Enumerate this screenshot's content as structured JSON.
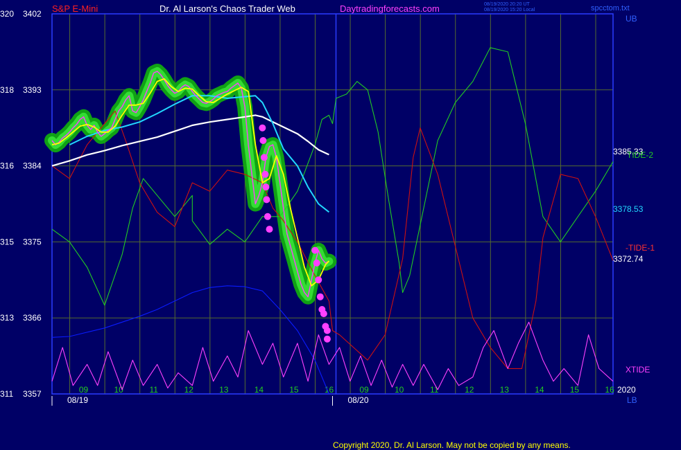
{
  "header": {
    "instrument": "S&P E-Mini",
    "site": "Dr. Al Larson's Chaos Trader Web",
    "url": "Daytradingforecasts.com",
    "stamp_ut": "08/19/2020 20:20 UT",
    "stamp_local": "08/19/2020 15:20 Local",
    "file": "spcctom.txt"
  },
  "footer": {
    "copyright": "Copyright 2020, Dr. Al Larson. May not be copied by any means."
  },
  "colors": {
    "background": "#000066",
    "frame": "#2a3cff",
    "grid": "#556b2f",
    "green_line": "#22cc22",
    "red_line": "#cc1111",
    "blue_line": "#0a1cff",
    "magenta_line": "#ff40ff",
    "cyan_ma": "#22d8ff",
    "white_ma": "#ffffff",
    "yellow_ma": "#ffff00",
    "glow": "#11aa11"
  },
  "chart_data": {
    "type": "line",
    "title": "S&P E-Mini",
    "ylim": [
      3357,
      3402
    ],
    "y_ticks": [
      {
        "left": "320",
        "price": "3402"
      },
      {
        "left": "318",
        "price": "3393"
      },
      {
        "left": "316",
        "price": "3384"
      },
      {
        "left": "315",
        "price": "3375"
      },
      {
        "left": "313",
        "price": "3366"
      },
      {
        "left": "311",
        "price": "3357"
      }
    ],
    "x_hour_labels": [
      {
        "label": "09",
        "x": 2.0
      },
      {
        "label": "10",
        "x": 3.0
      },
      {
        "label": "11",
        "x": 4.0
      },
      {
        "label": "12",
        "x": 5.0
      },
      {
        "label": "13",
        "x": 6.0
      },
      {
        "label": "14",
        "x": 7.0
      },
      {
        "label": "15",
        "x": 8.0
      },
      {
        "label": "16",
        "x": 9.0
      },
      {
        "label": "09",
        "x": 10.0
      },
      {
        "label": "10",
        "x": 11.0
      },
      {
        "label": "11",
        "x": 12.0
      },
      {
        "label": "12",
        "x": 13.0
      },
      {
        "label": "13",
        "x": 14.0
      },
      {
        "label": "14",
        "x": 15.0
      },
      {
        "label": "15",
        "x": 16.0
      },
      {
        "label": "16",
        "x": 17.0
      }
    ],
    "date_labels": [
      {
        "label": "08/19",
        "x": 1.0
      },
      {
        "label": "08/20",
        "x": 9.0
      }
    ],
    "right_labels": {
      "ub": "UB",
      "lb": "LB",
      "ma_white": "3385.33",
      "ma_cyan": "3378.53",
      "ma_yellow": "3372.74",
      "tide2": "TIDE-2",
      "tide1": "-TIDE-1",
      "xtide": "XTIDE",
      "year": "2020"
    },
    "series": [
      {
        "name": "price",
        "color": "#ff40ff",
        "x": [
          1.0,
          1.1,
          1.2,
          1.3,
          1.4,
          1.5,
          1.6,
          1.7,
          1.8,
          1.9,
          2.0,
          2.1,
          2.2,
          2.3,
          2.4,
          2.5,
          2.6,
          2.7,
          2.8,
          2.9,
          3.0,
          3.1,
          3.2,
          3.3,
          3.4,
          3.5,
          3.6,
          3.7,
          3.8,
          3.9,
          4.0,
          4.1,
          4.2,
          4.3,
          4.4,
          4.5,
          4.6,
          4.7,
          4.8,
          4.9,
          5.0,
          5.1,
          5.2,
          5.3,
          5.4,
          5.5,
          5.6,
          5.7,
          5.8,
          5.9,
          6.0,
          6.1,
          6.2,
          6.3,
          6.4,
          6.5,
          6.6,
          6.7,
          6.8,
          6.9,
          7.0,
          7.1,
          7.2,
          7.3,
          7.4,
          7.5,
          7.6,
          7.7,
          7.8,
          7.9,
          8.0,
          8.1,
          8.2,
          8.3,
          8.4,
          8.5,
          8.6,
          8.7,
          8.8,
          8.9
        ],
        "values": [
          3387.0,
          3386.5,
          3386.8,
          3387.3,
          3387.6,
          3388.0,
          3388.5,
          3388.9,
          3389.5,
          3389.8,
          3388.8,
          3388.3,
          3388.8,
          3388.0,
          3387.5,
          3387.8,
          3388.2,
          3388.5,
          3389.5,
          3390.5,
          3391.0,
          3391.8,
          3392.3,
          3390.5,
          3390.3,
          3391.0,
          3391.8,
          3392.8,
          3393.8,
          3395.0,
          3395.2,
          3394.8,
          3394.2,
          3393.5,
          3393.0,
          3392.6,
          3392.8,
          3393.3,
          3393.6,
          3393.4,
          3392.8,
          3392.3,
          3391.9,
          3391.5,
          3391.4,
          3391.6,
          3391.9,
          3392.3,
          3392.5,
          3392.7,
          3392.8,
          3393.2,
          3393.5,
          3393.8,
          3393.2,
          3391.0,
          3386.5,
          3383.0,
          3379.5,
          3380.5,
          3382.0,
          3385.0,
          3386.3,
          3386.5,
          3385.0,
          3382.0,
          3379.0,
          3376.0,
          3374.5,
          3373.0,
          3371.5,
          3370.0,
          3369.0,
          3368.5,
          3370.5,
          3372.5,
          3374.0,
          3373.0,
          3372.5,
          3372.7
        ]
      },
      {
        "name": "yellow-ma",
        "color": "#ffff00",
        "x": [
          1.0,
          1.2,
          1.4,
          1.6,
          1.8,
          2.0,
          2.2,
          2.4,
          2.6,
          2.8,
          3.0,
          3.2,
          3.4,
          3.6,
          3.8,
          4.0,
          4.2,
          4.4,
          4.6,
          4.8,
          5.0,
          5.2,
          5.4,
          5.6,
          5.8,
          6.0,
          6.2,
          6.4,
          6.6,
          6.8,
          7.0,
          7.2,
          7.4,
          7.6,
          7.8,
          8.0,
          8.2,
          8.4,
          8.6,
          8.8,
          8.9
        ],
        "values": [
          3386.5,
          3386.7,
          3387.3,
          3388.0,
          3388.7,
          3388.9,
          3388.6,
          3388.0,
          3388.0,
          3388.7,
          3390.0,
          3391.2,
          3391.2,
          3391.4,
          3392.6,
          3394.0,
          3394.3,
          3393.4,
          3392.8,
          3393.2,
          3393.1,
          3392.3,
          3391.6,
          3391.5,
          3392.0,
          3392.5,
          3392.9,
          3393.3,
          3392.8,
          3386.5,
          3382.0,
          3382.5,
          3385.2,
          3383.0,
          3379.0,
          3375.5,
          3372.0,
          3369.8,
          3370.5,
          3372.3,
          3372.74
        ]
      },
      {
        "name": "cyan-ma",
        "color": "#22d8ff",
        "x": [
          1.5,
          2.0,
          2.5,
          3.0,
          3.5,
          4.0,
          4.5,
          5.0,
          5.5,
          6.0,
          6.5,
          6.8,
          7.0,
          7.3,
          7.6,
          8.0,
          8.3,
          8.6,
          8.9
        ],
        "values": [
          3386.5,
          3387.5,
          3388.2,
          3388.6,
          3389.2,
          3390.2,
          3391.3,
          3392.3,
          3392.3,
          3392.0,
          3392.2,
          3392.3,
          3391.5,
          3389.0,
          3386.0,
          3384.0,
          3381.5,
          3379.5,
          3378.53
        ]
      },
      {
        "name": "white-ma",
        "color": "#ffffff",
        "x": [
          1.0,
          1.5,
          2.0,
          2.5,
          3.0,
          3.5,
          4.0,
          4.5,
          5.0,
          5.5,
          6.0,
          6.5,
          6.8,
          7.0,
          7.2,
          7.4,
          7.6,
          7.8,
          8.0,
          8.3,
          8.6,
          8.9
        ],
        "values": [
          3384.0,
          3384.6,
          3385.3,
          3385.8,
          3386.4,
          3386.9,
          3387.4,
          3388.1,
          3388.8,
          3389.2,
          3389.5,
          3389.8,
          3390.0,
          3389.8,
          3389.4,
          3389.0,
          3388.6,
          3388.2,
          3387.8,
          3386.9,
          3385.9,
          3385.33
        ]
      },
      {
        "name": "TIDE-2",
        "color": "#22cc22",
        "x": [
          1.0,
          1.5,
          2.0,
          2.5,
          3.0,
          3.3,
          3.6,
          4.0,
          4.5,
          5.0,
          5.0,
          5.5,
          6.0,
          6.5,
          7.0,
          7.5,
          8.0,
          8.5,
          8.7,
          8.9,
          9.0,
          9.1,
          9.4,
          9.7,
          10.0,
          10.3,
          10.6,
          10.9,
          11.0,
          11.2,
          11.5,
          12.0,
          12.5,
          13.0,
          13.5,
          14.0,
          14.5,
          15.0,
          15.5,
          16.0,
          16.5,
          17.0
        ],
        "values": [
          3376.5,
          3375.0,
          3372.0,
          3367.5,
          3373.5,
          3379.0,
          3382.5,
          3380.5,
          3378.0,
          3380.5,
          3377.5,
          3374.7,
          3376.5,
          3375.0,
          3378.0,
          3378.0,
          3381.0,
          3386.5,
          3389.5,
          3390.0,
          3389.0,
          3392.0,
          3392.5,
          3394.0,
          3393.0,
          3388.0,
          3380.0,
          3372.5,
          3369.0,
          3371.0,
          3377.0,
          3387.0,
          3391.5,
          3394.0,
          3398.0,
          3397.5,
          3389.0,
          3378.0,
          3375.0,
          3378.0,
          3381.0,
          3384.5
        ]
      },
      {
        "name": "TIDE-1",
        "color": "#cc1111",
        "x": [
          1.0,
          1.5,
          2.0,
          2.5,
          2.8,
          3.1,
          3.5,
          4.0,
          4.5,
          5.0,
          5.5,
          6.0,
          6.5,
          7.0,
          7.3,
          7.6,
          8.0,
          8.5,
          8.9,
          9.0,
          9.2,
          9.6,
          10.0,
          10.5,
          11.0,
          11.3,
          11.5,
          12.0,
          12.5,
          13.0,
          13.5,
          14.0,
          14.4,
          14.8,
          15.0,
          15.5,
          16.0,
          16.5,
          17.0
        ],
        "values": [
          3384.0,
          3382.5,
          3386.5,
          3389.0,
          3390.5,
          3387.0,
          3382.0,
          3378.5,
          3376.8,
          3382.0,
          3381.0,
          3383.5,
          3383.0,
          3382.0,
          3379.0,
          3377.5,
          3375.0,
          3371.0,
          3368.0,
          3364.5,
          3364.0,
          3362.5,
          3361.0,
          3364.0,
          3373.0,
          3385.0,
          3388.5,
          3383.0,
          3374.5,
          3366.0,
          3362.5,
          3360.0,
          3360.0,
          3368.0,
          3375.5,
          3383.0,
          3382.5,
          3378.0,
          3372.8
        ]
      },
      {
        "name": "blue",
        "color": "#0a1cff",
        "x": [
          1.0,
          1.5,
          2.0,
          2.5,
          3.0,
          3.5,
          4.0,
          4.5,
          5.0,
          5.5,
          6.0,
          6.5,
          7.0,
          7.5,
          8.0,
          8.5,
          8.9
        ],
        "values": [
          3363.7,
          3363.8,
          3364.3,
          3364.8,
          3365.5,
          3366.2,
          3367.0,
          3368.0,
          3369.0,
          3369.6,
          3369.8,
          3369.7,
          3369.2,
          3367.0,
          3364.5,
          3361.0,
          3357.0
        ]
      },
      {
        "name": "XTIDE",
        "color": "#ff40ff",
        "x": [
          1.0,
          1.3,
          1.6,
          2.0,
          2.3,
          2.6,
          3.0,
          3.3,
          3.6,
          4.0,
          4.3,
          4.6,
          5.0,
          5.3,
          5.6,
          6.0,
          6.3,
          6.6,
          7.0,
          7.3,
          7.6,
          8.0,
          8.3,
          8.6,
          8.9,
          9.2,
          9.5,
          9.8,
          10.1,
          10.4,
          10.7,
          11.0,
          11.3,
          11.6,
          12.0,
          12.3,
          12.6,
          13.0,
          13.3,
          13.6,
          14.0,
          14.3,
          14.6,
          15.0,
          15.3,
          15.6,
          16.0,
          16.3,
          16.6,
          17.0
        ],
        "values": [
          3358.5,
          3362.5,
          3358.0,
          3360.5,
          3358.0,
          3362.0,
          3357.5,
          3361.0,
          3358.0,
          3360.5,
          3357.7,
          3359.5,
          3358.0,
          3362.5,
          3358.5,
          3361.5,
          3359.0,
          3364.5,
          3360.5,
          3363.0,
          3359.0,
          3363.0,
          3358.5,
          3364.0,
          3360.5,
          3362.5,
          3358.5,
          3361.5,
          3358.0,
          3361.0,
          3357.8,
          3360.5,
          3358.0,
          3360.5,
          3357.5,
          3360.0,
          3358.0,
          3359.0,
          3362.5,
          3364.5,
          3360.0,
          3363.0,
          3365.5,
          3361.0,
          3358.5,
          3360.0,
          3358.0,
          3364.0,
          3360.0,
          3358.5
        ]
      }
    ],
    "points": {
      "name": "magenta dots",
      "color": "#ff40ff",
      "x": [
        7.0,
        7.02,
        7.05,
        7.08,
        7.1,
        7.12,
        7.15,
        7.2,
        8.5,
        8.55,
        8.6,
        8.65,
        8.7,
        8.75,
        8.8,
        8.85,
        8.85
      ],
      "values": [
        3388.5,
        3387.0,
        3385.0,
        3383.0,
        3381.5,
        3380.0,
        3378.0,
        3376.5,
        3374.0,
        3372.5,
        3370.5,
        3368.5,
        3367.0,
        3366.5,
        3365.0,
        3364.5,
        3363.5
      ]
    }
  }
}
